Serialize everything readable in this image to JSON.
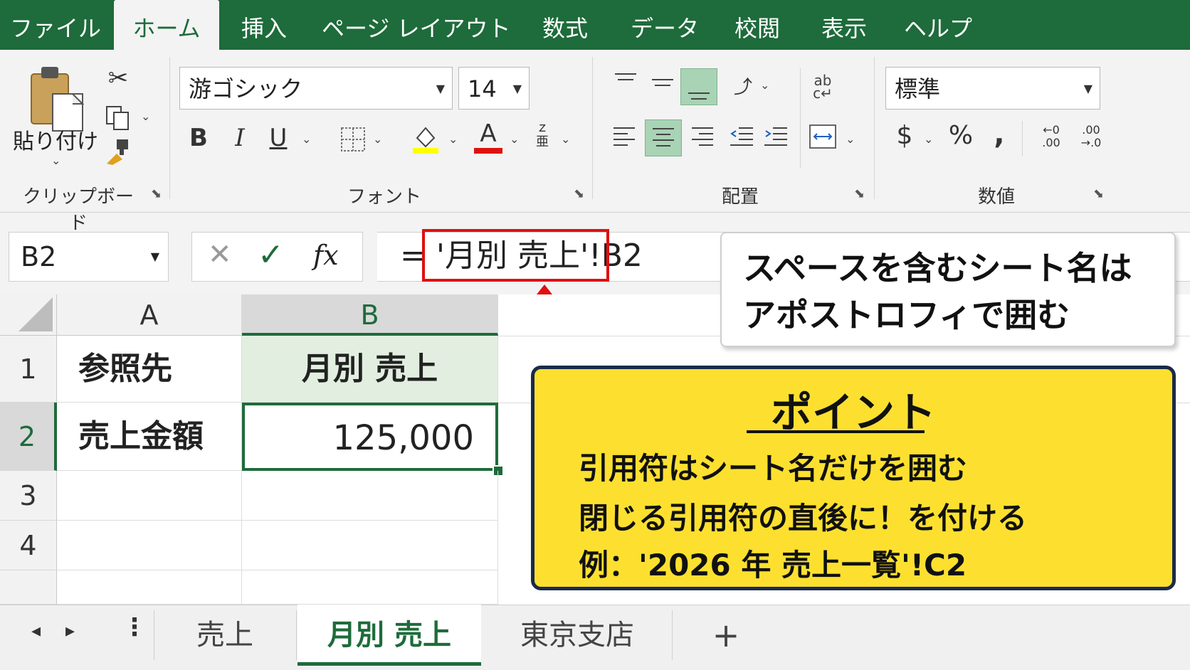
{
  "ribbon_tabs": [
    "ファイル",
    "ホーム",
    "挿入",
    "ページ レイアウト",
    "数式",
    "データ",
    "校閲",
    "表示",
    "ヘルプ"
  ],
  "active_tab": "ホーム",
  "ribbon": {
    "clipboard": {
      "paste_label": "貼り付け",
      "group_label": "クリップボード"
    },
    "font": {
      "family": "游ゴシック",
      "size": "14",
      "group_label": "フォント",
      "bold": "B",
      "italic": "I",
      "underline": "U",
      "font_color_glyph": "A",
      "phonetic_top": "ｚ",
      "phonetic_bottom": "亜",
      "highlight_color": "#ffff00",
      "text_color": "#e01010"
    },
    "alignment": {
      "group_label": "配置"
    },
    "number": {
      "format": "標準",
      "group_label": "数値",
      "currency": "$",
      "percent": "%",
      "comma": ",",
      "inc_decimal_top": "←0",
      "inc_decimal_bottom": ".00",
      "dec_decimal_top": ".00",
      "dec_decimal_bottom": "→.0"
    }
  },
  "formula_bar": {
    "name_box": "B2",
    "cancel_glyph": "✕",
    "enter_glyph": "✓",
    "fx_glyph": "fx",
    "formula_prefix": "=",
    "formula_sheet": "'月別 売上'",
    "formula_suffix": "!B2"
  },
  "grid": {
    "columns": [
      "A",
      "B"
    ],
    "rows": [
      "1",
      "2",
      "3",
      "4"
    ],
    "cells": {
      "A1": "参照先",
      "B1": "月別 売上",
      "A2": "売上金額",
      "B2": "125,000"
    },
    "selected_cell": "B2"
  },
  "callout_top": {
    "line1": "スペースを含むシート名は",
    "line2": "アポストロフィで囲む"
  },
  "callout_point": {
    "title": "ポイント",
    "lines": [
      "引用符はシート名だけを囲む",
      "閉じる引用符の直後に！を付ける",
      "例：'2026 年 売上一覧'!C2"
    ]
  },
  "sheet_tabs": [
    "売上",
    "月別 売上",
    "東京支店"
  ],
  "active_sheet": "月別 売上",
  "add_sheet_glyph": "+",
  "colors": {
    "accent": "#1e6b3b",
    "callout_yellow": "#fde02f",
    "highlight_red": "#e01010"
  }
}
